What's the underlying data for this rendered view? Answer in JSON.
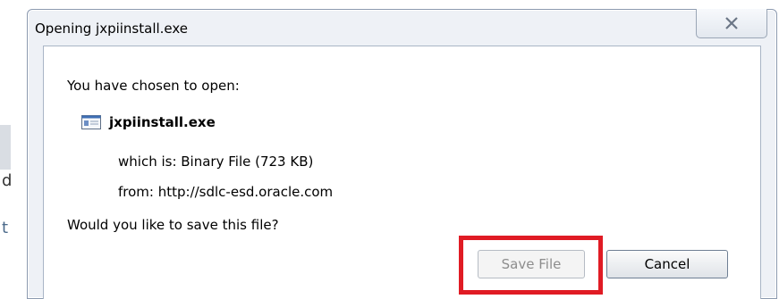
{
  "dialog": {
    "title": "Opening jxpiinstall.exe",
    "intro": "You have chosen to open:",
    "file_name": "jxpiinstall.exe",
    "which_is": "which is:  Binary File (723 KB)",
    "from": "from:  http://sdlc-esd.oracle.com",
    "question": "Would you like to save this file?",
    "save_label": "Save File",
    "cancel_label": "Cancel"
  },
  "background": {
    "glyph_1": "d",
    "glyph_2": "t"
  },
  "icons": {
    "close": "close-icon",
    "file": "file-icon"
  },
  "colors": {
    "highlight": "#e01b24",
    "dialog_frame": "#eef1f6",
    "disabled_text": "#8d8d8d"
  }
}
